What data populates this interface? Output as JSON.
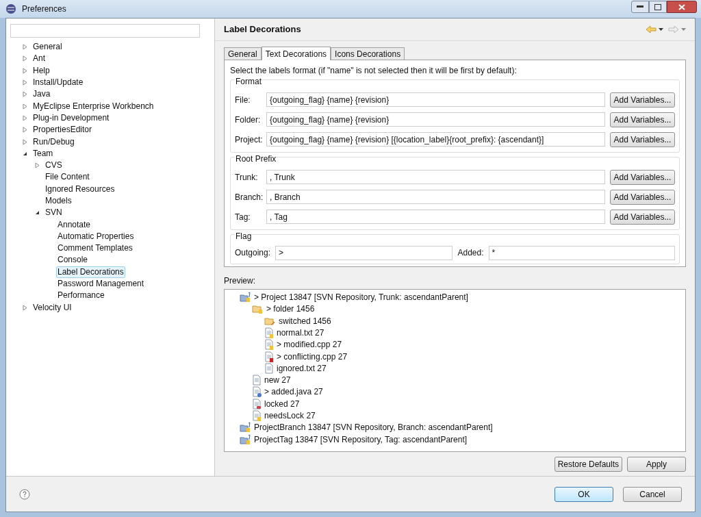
{
  "window": {
    "title": "Preferences"
  },
  "sidebar": {
    "items": [
      {
        "label": "General",
        "expanded": false,
        "selected": false
      },
      {
        "label": "Ant",
        "expanded": false,
        "selected": false
      },
      {
        "label": "Help",
        "expanded": false,
        "selected": false
      },
      {
        "label": "Install/Update",
        "expanded": false,
        "selected": false
      },
      {
        "label": "Java",
        "expanded": false,
        "selected": false
      },
      {
        "label": "MyEclipse Enterprise Workbench",
        "expanded": false,
        "selected": false
      },
      {
        "label": "Plug-in Development",
        "expanded": false,
        "selected": false
      },
      {
        "label": "PropertiesEditor",
        "expanded": false,
        "selected": false
      },
      {
        "label": "Run/Debug",
        "expanded": false,
        "selected": false
      },
      {
        "label": "Team",
        "expanded": true,
        "selected": false,
        "children": [
          {
            "label": "CVS",
            "expanded": false,
            "selected": false
          },
          {
            "label": "File Content",
            "selected": false
          },
          {
            "label": "Ignored Resources",
            "selected": false
          },
          {
            "label": "Models",
            "selected": false
          },
          {
            "label": "SVN",
            "expanded": true,
            "selected": false,
            "children": [
              {
                "label": "Annotate",
                "selected": false
              },
              {
                "label": "Automatic Properties",
                "selected": false
              },
              {
                "label": "Comment Templates",
                "selected": false
              },
              {
                "label": "Console",
                "selected": false
              },
              {
                "label": "Label Decorations",
                "selected": true
              },
              {
                "label": "Password Management",
                "selected": false
              },
              {
                "label": "Performance",
                "selected": false
              }
            ]
          }
        ]
      },
      {
        "label": "Velocity UI",
        "expanded": false,
        "selected": false
      }
    ]
  },
  "page": {
    "title": "Label Decorations",
    "tabs": [
      {
        "label": "General",
        "selected": false
      },
      {
        "label": "Text Decorations",
        "selected": true
      },
      {
        "label": "Icons Decorations",
        "selected": false
      }
    ],
    "instructions": "Select the labels format (if \"name\" is not selected then it will be first by default):",
    "groups": [
      {
        "title": "Format",
        "rows": [
          {
            "label": "File:",
            "value": "{outgoing_flag} {name} {revision}",
            "button": "Add Variables..."
          },
          {
            "label": "Folder:",
            "value": "{outgoing_flag} {name} {revision}",
            "button": "Add Variables..."
          },
          {
            "label": "Project:",
            "value": "{outgoing_flag} {name} {revision} [{location_label}{root_prefix}: {ascendant}]",
            "button": "Add Variables..."
          }
        ]
      },
      {
        "title": "Root Prefix",
        "rows": [
          {
            "label": "Trunk:",
            "value": ", Trunk",
            "button": "Add Variables..."
          },
          {
            "label": "Branch:",
            "value": ", Branch",
            "button": "Add Variables..."
          },
          {
            "label": "Tag:",
            "value": ", Tag",
            "button": "Add Variables..."
          }
        ]
      }
    ],
    "flag": {
      "title": "Flag",
      "fields": [
        {
          "label": "Outgoing:",
          "value": ">"
        },
        {
          "label": "Added:",
          "value": "*"
        }
      ]
    },
    "preview_label": "Preview:",
    "preview": [
      {
        "kind": "project",
        "label": "> Project 13847 [SVN Repository, Trunk: ascendantParent]",
        "children": [
          {
            "kind": "folder",
            "label": "> folder 1456",
            "children": [
              {
                "kind": "switched",
                "label": "switched 1456"
              },
              {
                "kind": "file",
                "label": "normal.txt 27"
              },
              {
                "kind": "file",
                "label": "> modified.cpp 27"
              },
              {
                "kind": "conflict",
                "label": "> conflicting.cpp 27"
              },
              {
                "kind": "ignored",
                "label": "ignored.txt 27"
              }
            ]
          },
          {
            "kind": "new",
            "label": "new 27"
          },
          {
            "kind": "added",
            "label": "> added.java 27"
          },
          {
            "kind": "locked",
            "label": "locked 27"
          },
          {
            "kind": "file",
            "label": "needsLock 27"
          }
        ]
      },
      {
        "kind": "project",
        "label": "ProjectBranch 13847 [SVN Repository, Branch: ascendantParent]"
      },
      {
        "kind": "project",
        "label": "ProjectTag 13847 [SVN Repository, Tag: ascendantParent]"
      }
    ],
    "buttons": [
      "Restore Defaults",
      "Apply"
    ]
  },
  "footer": {
    "buttons": [
      {
        "label": "OK",
        "kind": "default"
      },
      {
        "label": "Cancel",
        "kind": "normal"
      }
    ]
  }
}
